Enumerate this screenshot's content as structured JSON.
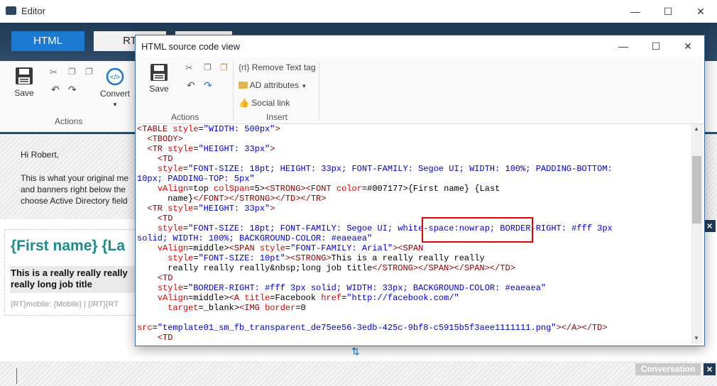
{
  "main": {
    "title": "Editor",
    "tabs": [
      "HTML",
      "RT"
    ],
    "ribbon": {
      "save": "Save",
      "convert": "Convert",
      "actions_group": "Actions"
    },
    "email": {
      "greeting": "Hi Robert,",
      "body_line1": "This is what your original me",
      "body_line2": "and banners right below the",
      "body_line3": "choose Active Directory field",
      "sig_name": "{First name} {La",
      "sig_title1": "This is a really really really",
      "sig_title2": "really long job title",
      "sig_contact": "{RT}mobile: {Mobile} | {/RT}{RT"
    },
    "conversation_label": "Conversation"
  },
  "dialog": {
    "title": "HTML source code view",
    "ribbon": {
      "save": "Save",
      "actions_group": "Actions",
      "remove_text_tag": "Remove Text tag",
      "ad_attributes": "AD attributes",
      "social_link": "Social link",
      "insert_group": "Insert"
    },
    "highlighted_text": "white-space:nowrap;"
  },
  "colors": {
    "accent": "#1d78d0",
    "titlebar_dark": "#1f3a54",
    "link_teal": "#1b8b8b",
    "highlight_box": "#e00000"
  }
}
